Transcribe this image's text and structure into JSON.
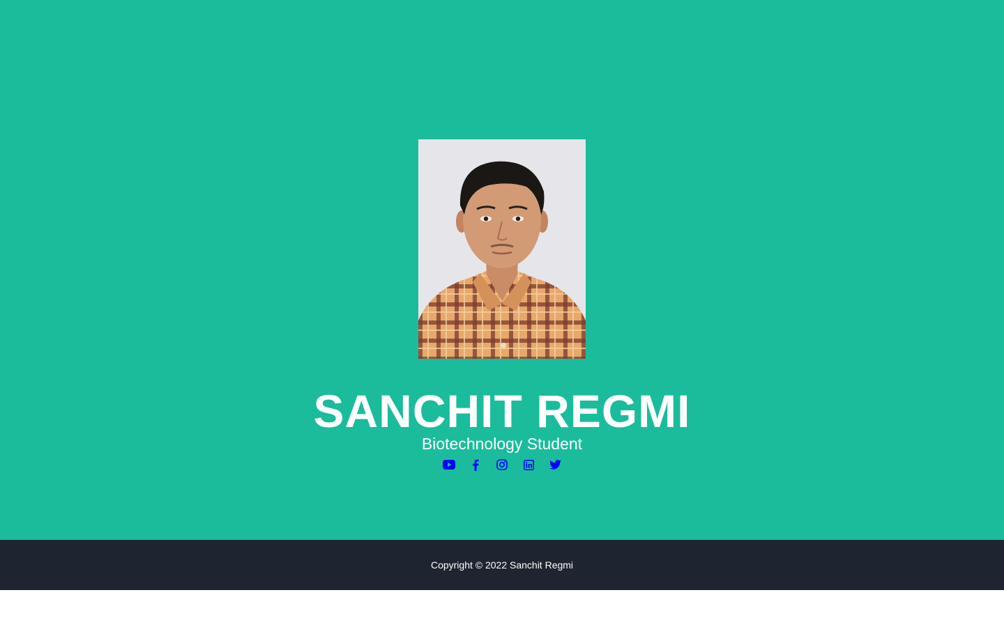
{
  "profile": {
    "name": "SANCHIT REGMI",
    "title": "Biotechnology Student",
    "photo_alt": "Portrait photo of Sanchit Regmi"
  },
  "social_links": [
    {
      "name": "youtube",
      "icon": "youtube-icon"
    },
    {
      "name": "facebook",
      "icon": "facebook-icon"
    },
    {
      "name": "instagram",
      "icon": "instagram-icon"
    },
    {
      "name": "linkedin",
      "icon": "linkedin-icon"
    },
    {
      "name": "twitter",
      "icon": "twitter-icon"
    }
  ],
  "footer": {
    "copyright": "Copyright © 2022 Sanchit Regmi"
  },
  "colors": {
    "hero_background": "#1abc9c",
    "footer_background": "#1e2530",
    "icon_color": "#0000ff",
    "text_color": "#ffffff"
  }
}
